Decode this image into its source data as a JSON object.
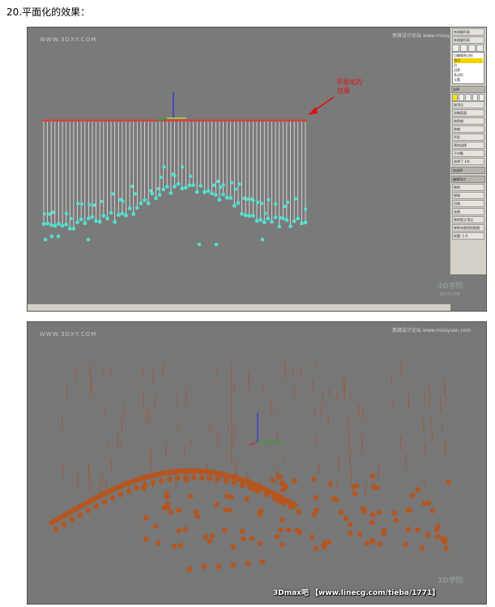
{
  "page": {
    "heading": "20.平面化的效果："
  },
  "top_view": {
    "site_watermark": "WWW.3DXY.COM",
    "forum_watermark": "思缘设计论坛 www.missyuan.com",
    "annotation_line1": "平面化的",
    "annotation_line2": "效果",
    "arrow_color": "#dd1111",
    "sphere_color": "#52e0cf",
    "plane_color": "#d44040",
    "line_color": "#e8e8e8",
    "corner_badge": "3D学院",
    "corner_badge_sub": "3DXY.COM",
    "panel": {
      "modifier_list": "修改器列表",
      "items": [
        "可编辑多边形",
        "顶点",
        "边",
        "边界",
        "多边形",
        "元素"
      ],
      "selected_index": 1,
      "rollout_selection": "选择",
      "checkboxes": [
        "按顶点",
        "忽略背面",
        "按角度:"
      ],
      "shrink_label": "收缩",
      "grow_label": "扩大",
      "ring_label": "环形",
      "preview_label": "预览选择",
      "disabled_label": "禁用",
      "subobject_label": "子对象",
      "selected_count": "选择了 1/6",
      "soft_sel": "软选择",
      "edit_vertices": "编辑顶点",
      "remove_label": "移除",
      "weld_label": "焊接",
      "chamfer_label": "切角",
      "connect_label": "连接",
      "remove_isolated": "移除孤立顶点",
      "remove_unused": "移除未使用的贴图",
      "weight_label": "权重:",
      "weight_value": "1.0"
    }
  },
  "bottom_view": {
    "site_watermark": "WWW.3DXY.COM",
    "forum_watermark": "思缘设计论坛 www.missyuan.com",
    "sphere_color": "#b5551f",
    "line_color": "#9a5a3a",
    "corner_badge": "3D学院",
    "bottom_tag": "3Dmax吧 【www.linecg.com/tieba/1771】"
  }
}
